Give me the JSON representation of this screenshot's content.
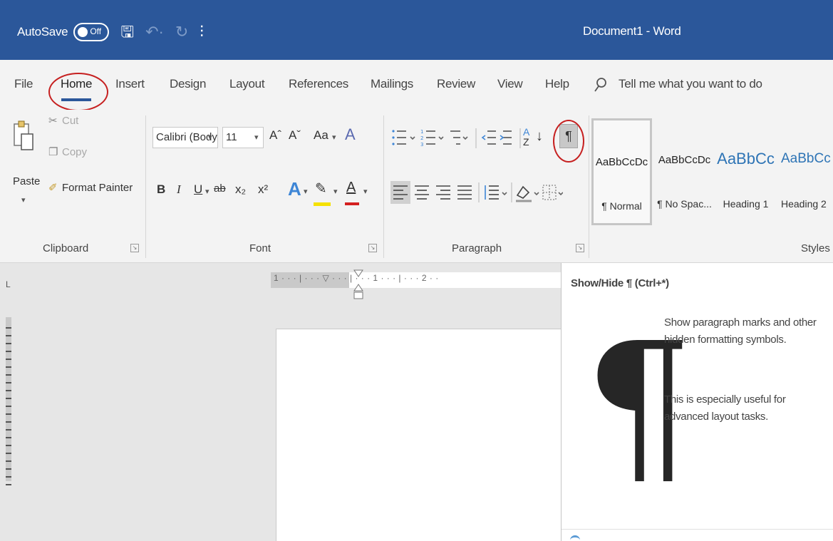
{
  "titlebar": {
    "autosave_label": "AutoSave",
    "autosave_state": "Off",
    "document_title": "Document1 - Word",
    "save_glyph": "🖫",
    "undo_glyph": "↶·",
    "redo_glyph": "↻",
    "customize_glyph": "⫶"
  },
  "tabs": {
    "items": [
      "File",
      "Home",
      "Insert",
      "Design",
      "Layout",
      "References",
      "Mailings",
      "Review",
      "View",
      "Help"
    ],
    "active": "Home",
    "tell_me": "Tell me what you want to do",
    "tell_me_icon": "lightbulb-icon"
  },
  "ribbon": {
    "clipboard": {
      "label": "Clipboard",
      "paste": "Paste",
      "cut": "Cut",
      "copy": "Copy",
      "format_painter": "Format Painter"
    },
    "font": {
      "label": "Font",
      "font_name": "Calibri (Body)",
      "font_size": "11",
      "grow": "Aˆ",
      "shrink": "Aˇ",
      "change_case": "Aa",
      "bold": "B",
      "italic": "I",
      "underline": "U",
      "strike": "ab",
      "subscript": "x₂",
      "superscript": "x²"
    },
    "paragraph": {
      "label": "Paragraph",
      "show_hide": "¶",
      "sort": "A↓"
    },
    "styles": {
      "label": "Styles",
      "items": [
        {
          "sample": "AaBbCcDc",
          "name": "¶ Normal"
        },
        {
          "sample": "AaBbCcDc",
          "name": "¶ No Spac..."
        },
        {
          "sample": "AaBbCc",
          "name": "Heading 1"
        },
        {
          "sample": "AaBbCc",
          "name": "Heading 2"
        }
      ]
    }
  },
  "ruler": {
    "text": "1 · · · | · · · ▽ · · · | · · · 1 · · · | · · · 2 · ·",
    "corner": "L"
  },
  "tooltip": {
    "title": "Show/Hide ¶ (Ctrl+*)",
    "glyph": "¶",
    "line1": "Show paragraph marks and other hidden formatting symbols.",
    "line2": "This is especially useful for advanced layout tasks."
  },
  "colors": {
    "title_bar": "#2b579a",
    "annotation_circle": "#c62020",
    "highlight": "#f5e100",
    "font_color": "#d42020"
  }
}
